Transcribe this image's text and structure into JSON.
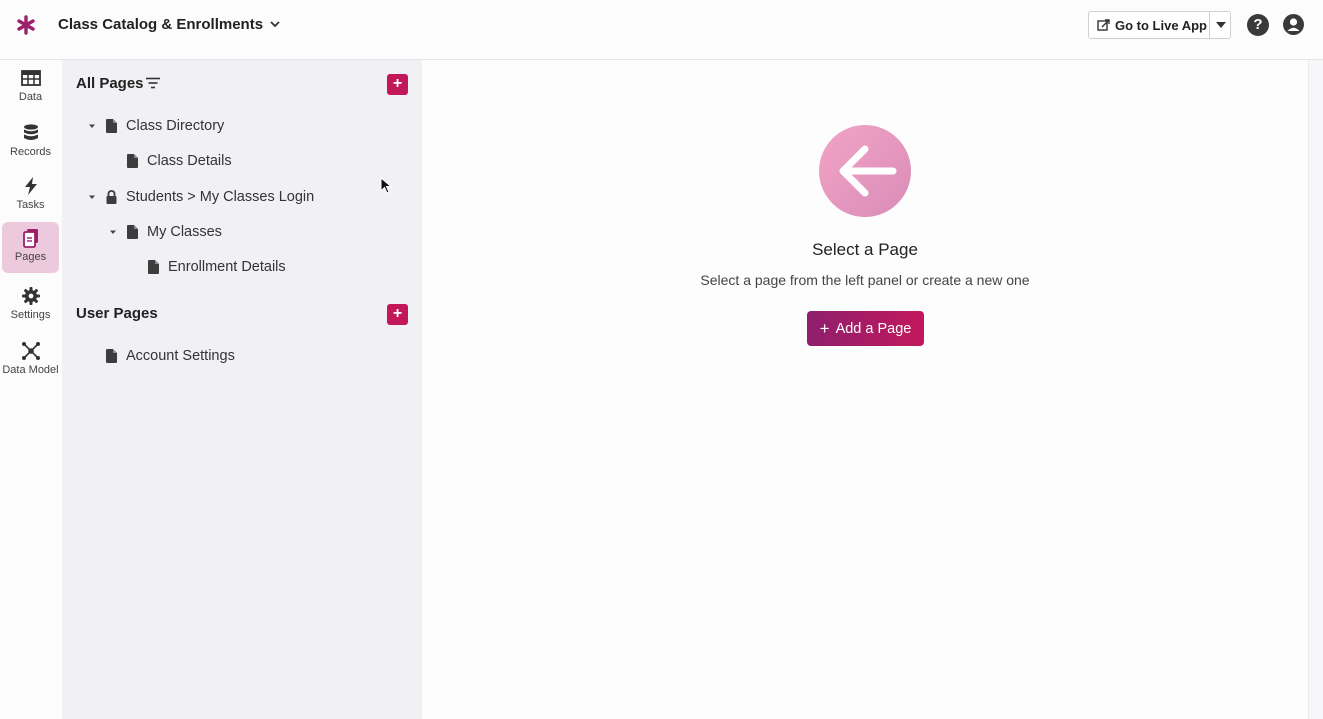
{
  "header": {
    "app_title": "Class Catalog & Enrollments",
    "live_app_label": "Go to Live App"
  },
  "nav": {
    "items": [
      {
        "label": "Data",
        "icon": "table-icon"
      },
      {
        "label": "Records",
        "icon": "database-icon"
      },
      {
        "label": "Tasks",
        "icon": "bolt-icon"
      },
      {
        "label": "Pages",
        "icon": "pages-icon",
        "active": true
      },
      {
        "label": "Settings",
        "icon": "gear-icon"
      },
      {
        "label": "Data Model",
        "icon": "network-icon"
      }
    ]
  },
  "panel": {
    "all_pages_title": "All Pages",
    "user_pages_title": "User Pages",
    "tree": [
      {
        "label": "Class Directory"
      },
      {
        "label": "Class Details"
      },
      {
        "label": "Students > My Classes Login"
      },
      {
        "label": "My Classes"
      },
      {
        "label": "Enrollment Details"
      }
    ],
    "user_tree": [
      {
        "label": "Account Settings"
      }
    ]
  },
  "main": {
    "empty_title": "Select a Page",
    "empty_subtitle": "Select a page from the left panel or create a new one",
    "add_page_label": "Add a Page"
  },
  "colors": {
    "accent": "#c2185b",
    "accent_dark": "#8e1f6e",
    "active_nav_bg": "#ecc9dd"
  }
}
